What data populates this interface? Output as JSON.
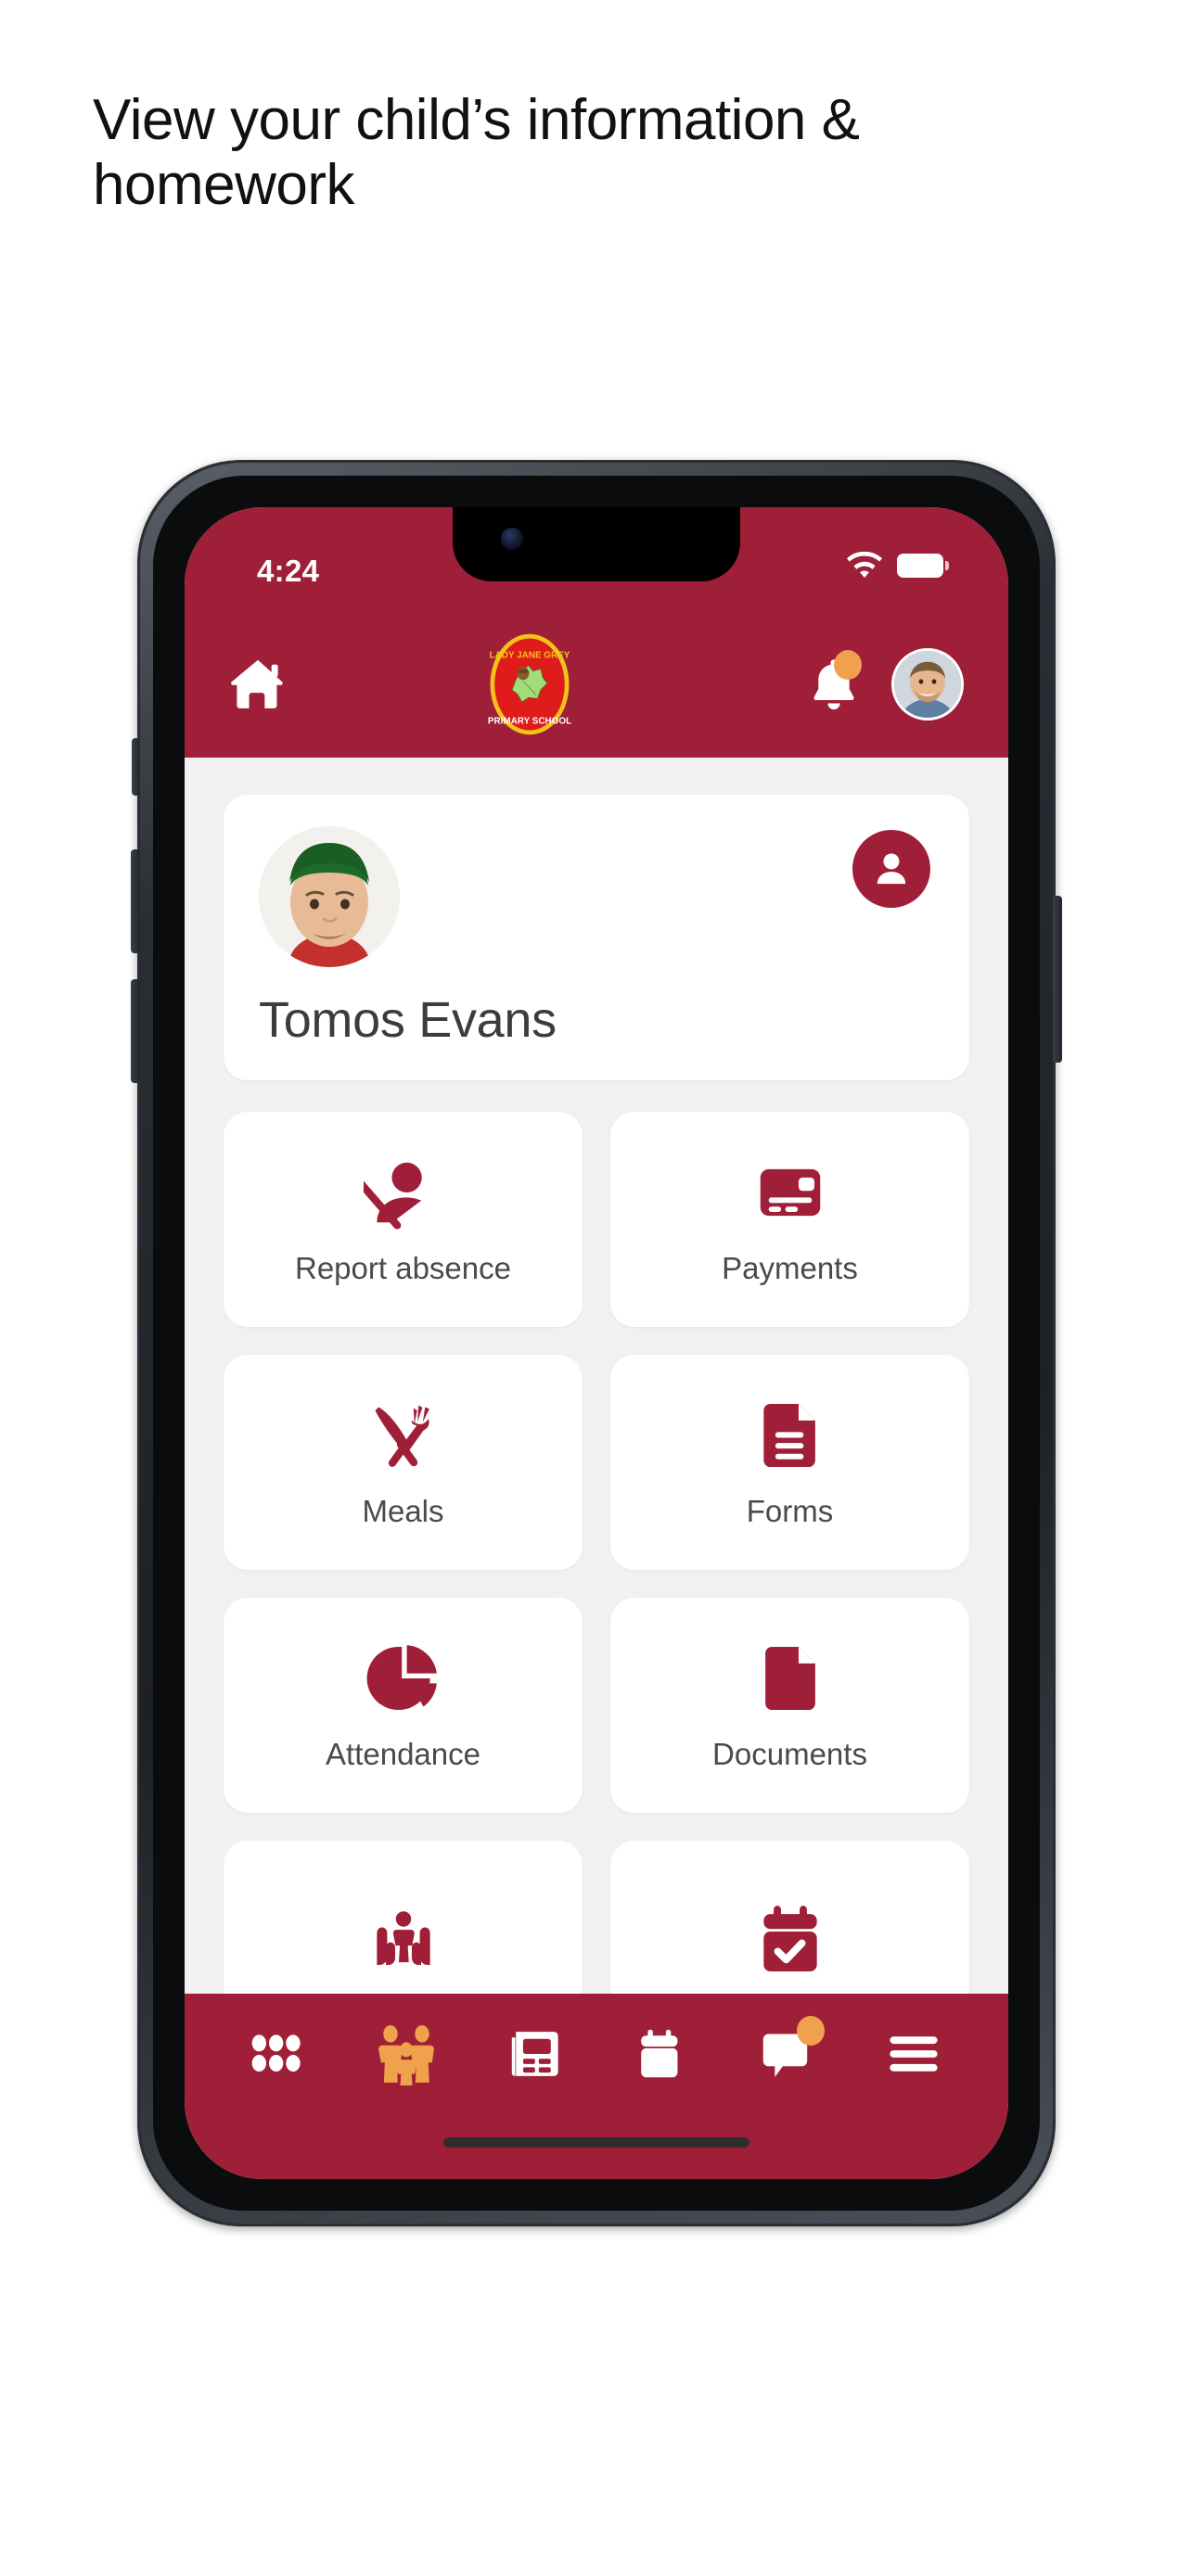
{
  "heading": "View your child’s information & homework",
  "colors": {
    "brand_crimson": "#A01F38",
    "accent_orange": "#F0A14B",
    "screen_bg": "#f1f1f1",
    "card_white": "#ffffff"
  },
  "status_bar": {
    "time": "4:24",
    "wifi_icon": "wifi-icon",
    "battery_icon": "battery-icon"
  },
  "app_header": {
    "home_icon": "home-icon",
    "logo": {
      "name": "lady-jane-grey-primary-school-logo",
      "top_text": "LADY JANE GREY",
      "bottom_text": "PRIMARY SCHOOL"
    },
    "notifications_icon": "bell-icon",
    "notifications_badge": "",
    "account_avatar": "parent-avatar"
  },
  "student_card": {
    "name": "Tomos Evans",
    "photo": "student-photo",
    "profile_icon": "person-icon"
  },
  "tiles": [
    {
      "label": "Report absence",
      "icon": "person-slash-icon"
    },
    {
      "label": "Payments",
      "icon": "credit-card-icon"
    },
    {
      "label": "Meals",
      "icon": "cutlery-icon"
    },
    {
      "label": "Forms",
      "icon": "document-lines-icon"
    },
    {
      "label": "Attendance",
      "icon": "pie-chart-icon"
    },
    {
      "label": "Documents",
      "icon": "document-icon"
    },
    {
      "label": "",
      "icon": "hands-child-icon"
    },
    {
      "label": "",
      "icon": "calendar-check-icon"
    }
  ],
  "bottom_nav": [
    {
      "name": "apps-grid",
      "icon": "grid-dots-icon",
      "active": false
    },
    {
      "name": "family",
      "icon": "family-icon",
      "active": true
    },
    {
      "name": "news",
      "icon": "newspaper-icon",
      "active": false
    },
    {
      "name": "calendar",
      "icon": "calendar-icon",
      "active": false
    },
    {
      "name": "messages",
      "icon": "chat-bubble-icon",
      "active": false,
      "badge": true
    },
    {
      "name": "menu",
      "icon": "hamburger-menu-icon",
      "active": false
    }
  ]
}
